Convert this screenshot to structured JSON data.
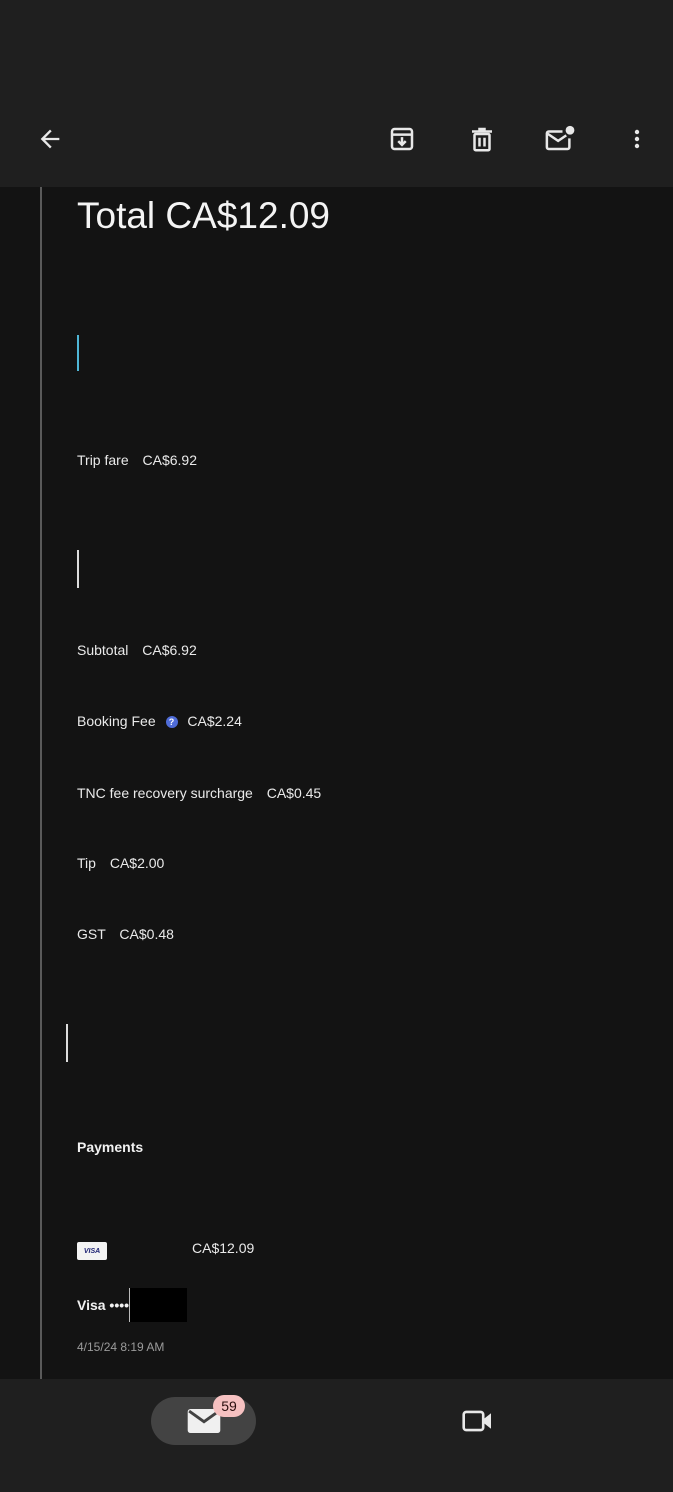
{
  "receipt": {
    "total": "Total CA$12.09",
    "trip_fare": {
      "label": "Trip fare",
      "amount": "CA$6.92"
    },
    "subtotal": {
      "label": "Subtotal",
      "amount": "CA$6.92"
    },
    "booking_fee": {
      "label": "Booking Fee",
      "info": "?",
      "amount": "CA$2.24"
    },
    "tnc_fee": {
      "label": "TNC fee recovery surcharge",
      "amount": "CA$0.45"
    },
    "tip": {
      "label": "Tip",
      "amount": "CA$2.00"
    },
    "gst": {
      "label": "GST",
      "amount": "CA$0.48"
    }
  },
  "payments": {
    "heading": "Payments",
    "card_brand": "VISA",
    "amount": "CA$12.09",
    "card_label": "Visa ••••",
    "timestamp": "4/15/24 8:19 AM"
  },
  "bottom_nav": {
    "mail_badge": "59"
  },
  "icons": {
    "toolbar": [
      "back-arrow-icon",
      "archive-icon",
      "delete-icon",
      "mark-unread-icon",
      "more-vert-icon"
    ],
    "bottom_nav": [
      "mail-icon",
      "video-camera-icon"
    ]
  },
  "colors": {
    "background": "#131313",
    "bars": "#1f1f1f",
    "badge": "#f6c1c1",
    "info_badge": "#4f6cd8",
    "cursor_accent": "#4fb6d6"
  }
}
